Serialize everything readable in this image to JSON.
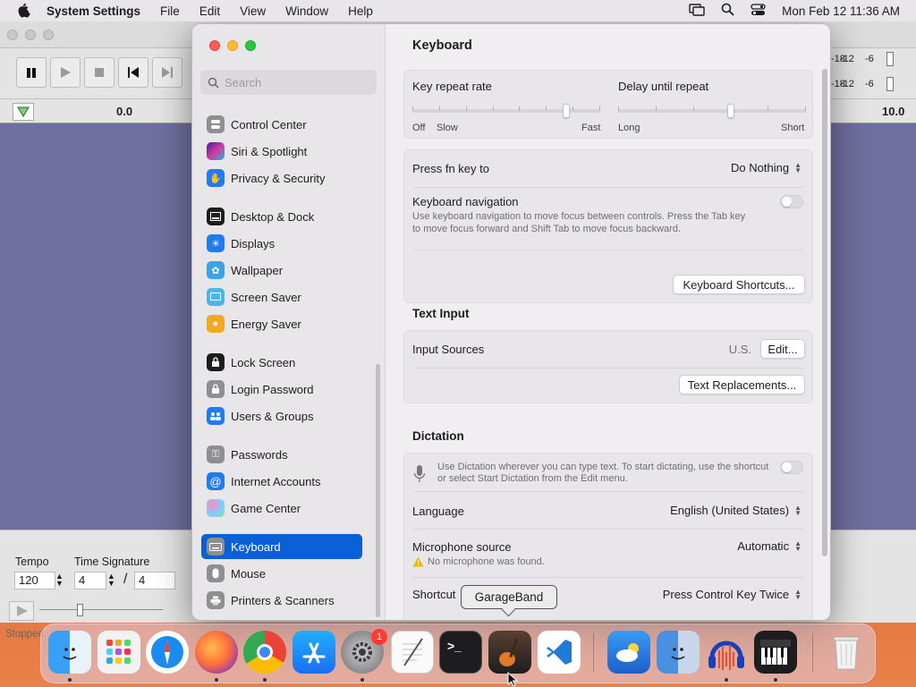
{
  "menubar": {
    "app_name": "System Settings",
    "items": [
      "File",
      "Edit",
      "View",
      "Window",
      "Help"
    ],
    "clock": "Mon Feb 12  11:36 AM"
  },
  "bg_window": {
    "ruler_left": "0.0",
    "ruler_right": "10.0",
    "meter_labels": [
      "-18",
      "-12",
      "-6",
      "-18",
      "-12",
      "-6"
    ],
    "tempo_label": "Tempo",
    "tempo_value": "120",
    "time_signature_label": "Time Signature",
    "ts_top": "4",
    "ts_slash": "/",
    "ts_bottom": "4",
    "status": "Stopped."
  },
  "sidebar": {
    "search_placeholder": "Search",
    "items": [
      {
        "label": "Control Center",
        "color": "#8e8e93",
        "icon": "toggles-icon"
      },
      {
        "label": "Siri & Spotlight",
        "color": "#6a3fc7",
        "icon": "siri-icon"
      },
      {
        "label": "Privacy & Security",
        "color": "#1f7bef",
        "icon": "hand-icon"
      },
      {
        "label": "Desktop & Dock",
        "color": "#1d1d1f",
        "icon": "dock-icon"
      },
      {
        "label": "Displays",
        "color": "#1f7bef",
        "icon": "sun-icon"
      },
      {
        "label": "Wallpaper",
        "color": "#3ba3e8",
        "icon": "flower-icon"
      },
      {
        "label": "Screen Saver",
        "color": "#4fb5e8",
        "icon": "screensaver-icon"
      },
      {
        "label": "Energy Saver",
        "color": "#f5a623",
        "icon": "bulb-icon"
      },
      {
        "label": "Lock Screen",
        "color": "#1d1d1f",
        "icon": "lock-icon"
      },
      {
        "label": "Login Password",
        "color": "#8e8e93",
        "icon": "lock-icon"
      },
      {
        "label": "Users & Groups",
        "color": "#1f7bef",
        "icon": "users-icon"
      },
      {
        "label": "Passwords",
        "color": "#8e8e93",
        "icon": "key-icon"
      },
      {
        "label": "Internet Accounts",
        "color": "#1f7bef",
        "icon": "at-icon"
      },
      {
        "label": "Game Center",
        "color": "#e85a9a",
        "icon": "game-center-icon"
      },
      {
        "label": "Keyboard",
        "color": "#8e8e93",
        "icon": "keyboard-icon"
      },
      {
        "label": "Mouse",
        "color": "#8e8e93",
        "icon": "mouse-icon"
      },
      {
        "label": "Printers & Scanners",
        "color": "#8e8e93",
        "icon": "printer-icon"
      }
    ],
    "selected": "Keyboard"
  },
  "content": {
    "title": "Keyboard",
    "key_repeat": {
      "label": "Key repeat rate",
      "off": "Off",
      "slow": "Slow",
      "fast": "Fast",
      "value": 0.82
    },
    "delay_repeat": {
      "label": "Delay until repeat",
      "long": "Long",
      "short": "Short",
      "value": 0.6
    },
    "fn_key": {
      "label": "Press fn key to",
      "value": "Do Nothing"
    },
    "kb_nav": {
      "label": "Keyboard navigation",
      "desc1": "Use keyboard navigation to move focus between controls. Press the Tab key",
      "desc2": "to move focus forward and Shift Tab to move focus backward."
    },
    "shortcuts_button": "Keyboard Shortcuts...",
    "text_input_header": "Text Input",
    "input_sources": {
      "label": "Input Sources",
      "value": "U.S.",
      "button": "Edit..."
    },
    "text_replacements_button": "Text Replacements...",
    "dictation_header": "Dictation",
    "dictation_desc1": "Use Dictation wherever you can type text. To start dictating, use the shortcut",
    "dictation_desc2": "or select Start Dictation from the Edit menu.",
    "language": {
      "label": "Language",
      "value": "English (United States)"
    },
    "mic": {
      "label": "Microphone source",
      "value": "Automatic",
      "warning": "No microphone was found."
    },
    "shortcut": {
      "label": "Shortcut",
      "value": "Press Control Key Twice"
    }
  },
  "tooltip": "GarageBand",
  "dock": {
    "badge": "1",
    "apps": [
      {
        "name": "finder-icon",
        "color": "#2d8cf0"
      },
      {
        "name": "launchpad-icon",
        "color": "#e8e8e8"
      },
      {
        "name": "safari-icon",
        "color": "#1a8cf0"
      },
      {
        "name": "firefox-icon",
        "color": "#7a2bd6"
      },
      {
        "name": "chrome-icon",
        "color": "#ffffff"
      },
      {
        "name": "app-store-icon",
        "color": "#1b8af2"
      },
      {
        "name": "system-settings-icon",
        "color": "#8a8a8e"
      },
      {
        "name": "textedit-icon",
        "color": "#f4f4f4"
      },
      {
        "name": "terminal-icon",
        "color": "#1d1d1f"
      },
      {
        "name": "garageband-icon",
        "color": "#2a2a2a"
      },
      {
        "name": "vscode-icon",
        "color": "#ffffff"
      },
      {
        "name": "weather-icon",
        "color": "#2b7fd8"
      },
      {
        "name": "preview-icon",
        "color": "#6f8fb5"
      },
      {
        "name": "audacity-icon",
        "color": "#1a3fb8"
      },
      {
        "name": "piano-icon",
        "color": "#222222"
      },
      {
        "name": "trash-icon",
        "color": "#dcdcdc"
      }
    ]
  }
}
